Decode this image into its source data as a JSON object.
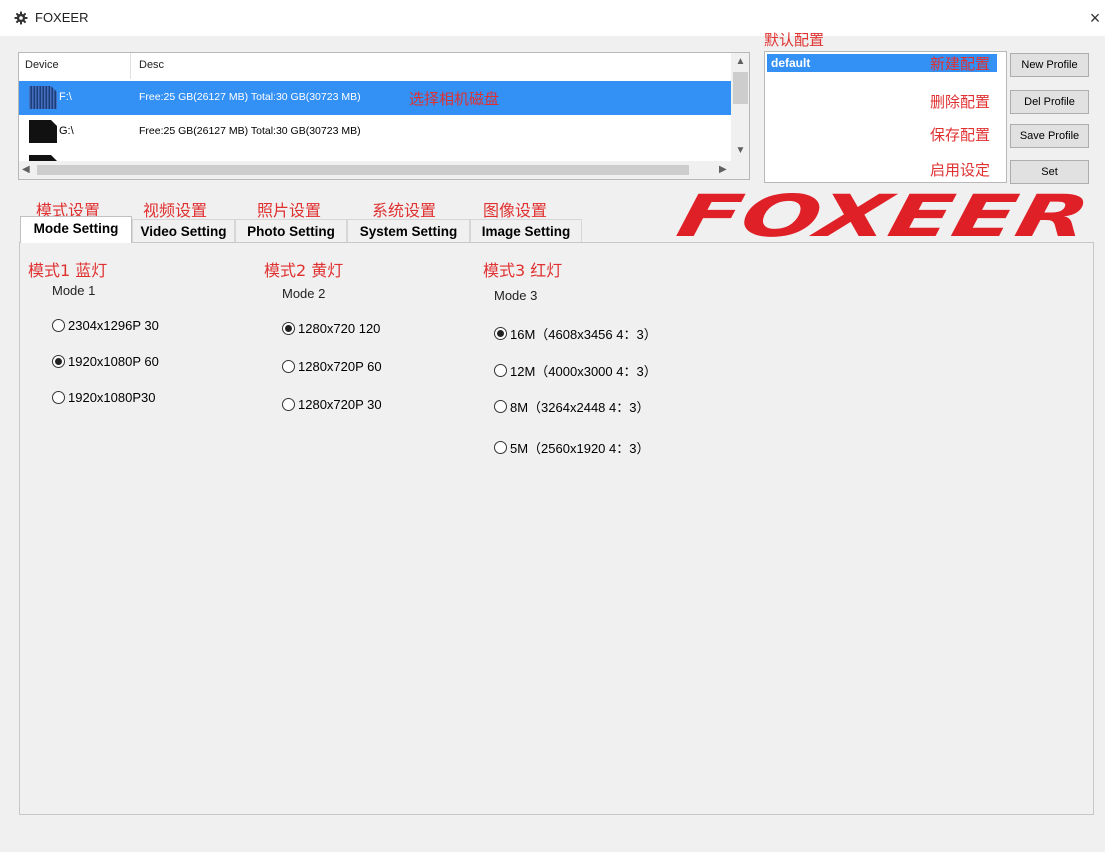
{
  "window": {
    "title": "FOXEER",
    "app_icon": "gear-icon",
    "close_label": "×"
  },
  "device_list": {
    "columns": [
      "Device",
      "Desc"
    ],
    "rows": [
      {
        "device": "F:\\",
        "desc": "Free:25 GB(26127 MB) Total:30 GB(30723 MB)",
        "selected": true,
        "icon": "sd-card-icon"
      },
      {
        "device": "G:\\",
        "desc": "Free:25 GB(26127 MB) Total:30 GB(30723 MB)",
        "selected": false,
        "icon": "sd-card-icon"
      },
      {
        "device": "",
        "desc": "",
        "selected": false,
        "icon": "sd-card-icon"
      }
    ],
    "annotation": "选择相机磁盘"
  },
  "profile": {
    "annotation_title": "默认配置",
    "selected": "default",
    "buttons": [
      {
        "label": "New Profile",
        "annotation": "新建配置"
      },
      {
        "label": "Del Profile",
        "annotation": "删除配置"
      },
      {
        "label": "Save Profile",
        "annotation": "保存配置"
      },
      {
        "label": "Set",
        "annotation": "启用设定"
      }
    ]
  },
  "logo": {
    "text": "FOXEER",
    "color": "#e02027"
  },
  "tabs": [
    {
      "label": "Mode Setting",
      "annotation": "模式设置",
      "active": true
    },
    {
      "label": "Video Setting",
      "annotation": "视频设置",
      "active": false
    },
    {
      "label": "Photo Setting",
      "annotation": "照片设置",
      "active": false
    },
    {
      "label": "System Setting",
      "annotation": "系统设置",
      "active": false
    },
    {
      "label": "Image Setting",
      "annotation": "图像设置",
      "active": false
    }
  ],
  "modes": [
    {
      "annotation": "模式1 蓝灯",
      "label": "Mode 1",
      "options": [
        {
          "label": "2304x1296P 30",
          "selected": false
        },
        {
          "label": "1920x1080P 60",
          "selected": true
        },
        {
          "label": "1920x1080P30",
          "selected": false
        }
      ]
    },
    {
      "annotation": "模式2 黄灯",
      "label": "Mode 2",
      "options": [
        {
          "label": "1280x720 120",
          "selected": true
        },
        {
          "label": "1280x720P 60",
          "selected": false
        },
        {
          "label": "1280x720P 30",
          "selected": false
        }
      ]
    },
    {
      "annotation": "模式3 红灯",
      "label": "Mode 3",
      "options": [
        {
          "label": "16M（4608x3456 4：3）",
          "selected": true
        },
        {
          "label": "12M（4000x3000 4：3）",
          "selected": false
        },
        {
          "label": "8M（3264x2448 4：3）",
          "selected": false
        },
        {
          "label": "5M（2560x1920 4：3）",
          "selected": false
        }
      ]
    }
  ],
  "colors": {
    "selection": "#3390f5",
    "annotation": "#e03131",
    "background": "#f0f0f0"
  }
}
